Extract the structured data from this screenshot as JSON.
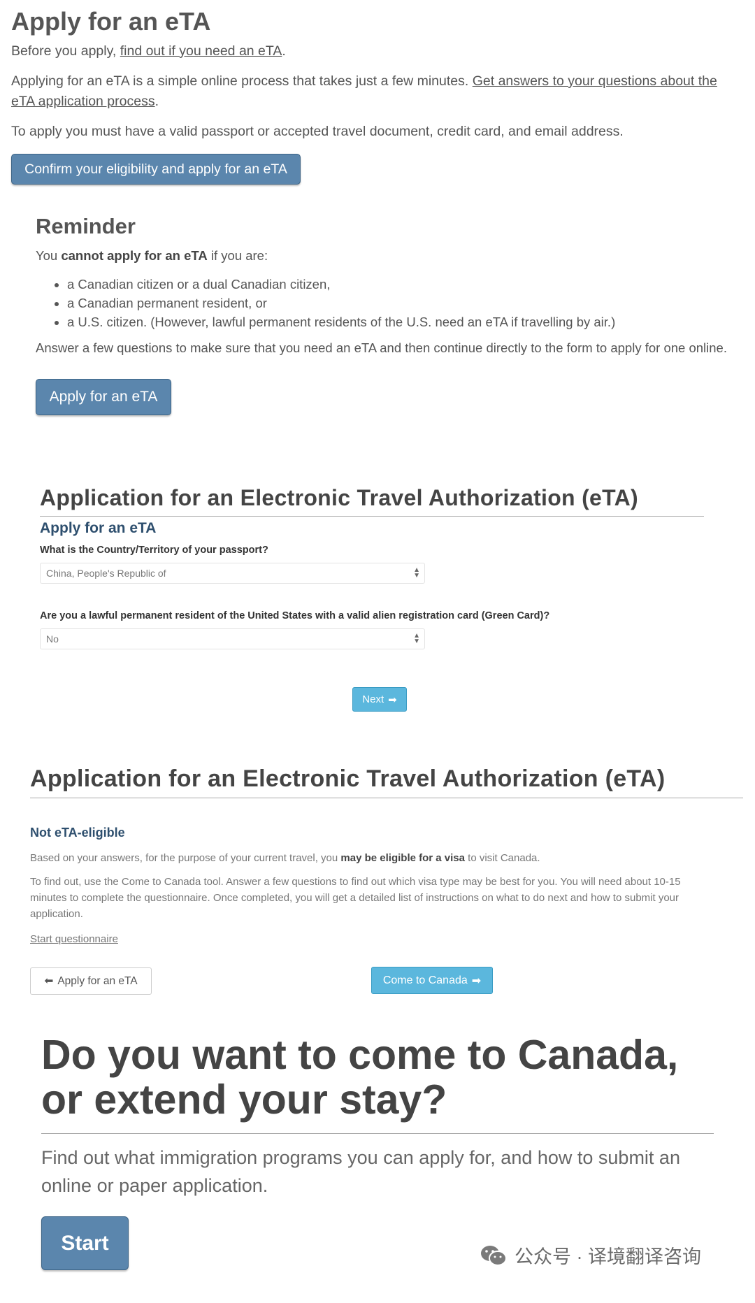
{
  "section1": {
    "title": "Apply for an eTA",
    "p1_before": "Before you apply, ",
    "p1_link": "find out if you need an eTA",
    "p1_after": ".",
    "p2_before": "Applying for an eTA is a simple online process that takes just a few minutes. ",
    "p2_link_line1": "Get answers to your questions about the",
    "p2_link_line2": "eTA application process",
    "p2_after": ".",
    "p3": "To apply you must have a valid passport or accepted travel document, credit card, and email address.",
    "button": "Confirm your eligibility and apply for an eTA"
  },
  "reminder": {
    "title": "Reminder",
    "intro_before": "You ",
    "intro_bold": "cannot apply for an eTA",
    "intro_after": " if you are:",
    "items": [
      "a Canadian citizen or a dual Canadian citizen,",
      "a Canadian permanent resident, or",
      "a U.S. citizen. (However, lawful permanent residents of the U.S. need an eTA if travelling by air.)"
    ],
    "note": "Answer a few questions to make sure that you need an eTA and then continue directly to the form to apply for one online.",
    "button": "Apply for an eTA"
  },
  "form": {
    "title": "Application for an Electronic Travel Authorization (eTA)",
    "subtitle": "Apply for an eTA",
    "q1_label": "What is the Country/Territory of your passport?",
    "q1_value": "China, People's Republic of",
    "q2_label": "Are you a lawful permanent resident of the United States with a valid alien registration card (Green Card)?",
    "q2_value": "No",
    "next_button": "Next"
  },
  "result": {
    "title": "Application for an Electronic Travel Authorization (eTA)",
    "subtitle": "Not eTA-eligible",
    "p1_before": "Based on your answers, for the purpose of your current travel, you ",
    "p1_bold": "may be eligible for a visa",
    "p1_after": " to visit Canada.",
    "p2_line1": "To find out, use the Come to Canada tool.  Answer a few questions to find out which visa type may be best for you.  You will need about 10-15",
    "p2_line2": "minutes to complete the questionnaire.  Once completed, you will get a detailed list of instructions on what to do next and how to submit your",
    "p2_line3": "application.",
    "link": "Start questionnaire",
    "back_button": "Apply for an eTA",
    "come_button": "Come to Canada"
  },
  "come": {
    "heading_line1": "Do you want to come to Canada,",
    "heading_line2": "or extend your stay?",
    "lead_line1": "Find out what immigration programs you can apply for, and how to submit an",
    "lead_line2": "online or paper application.",
    "start_button": "Start"
  },
  "watermark": {
    "text": "公众号 · 译境翻译咨询",
    "icon": "wechat-icon"
  }
}
